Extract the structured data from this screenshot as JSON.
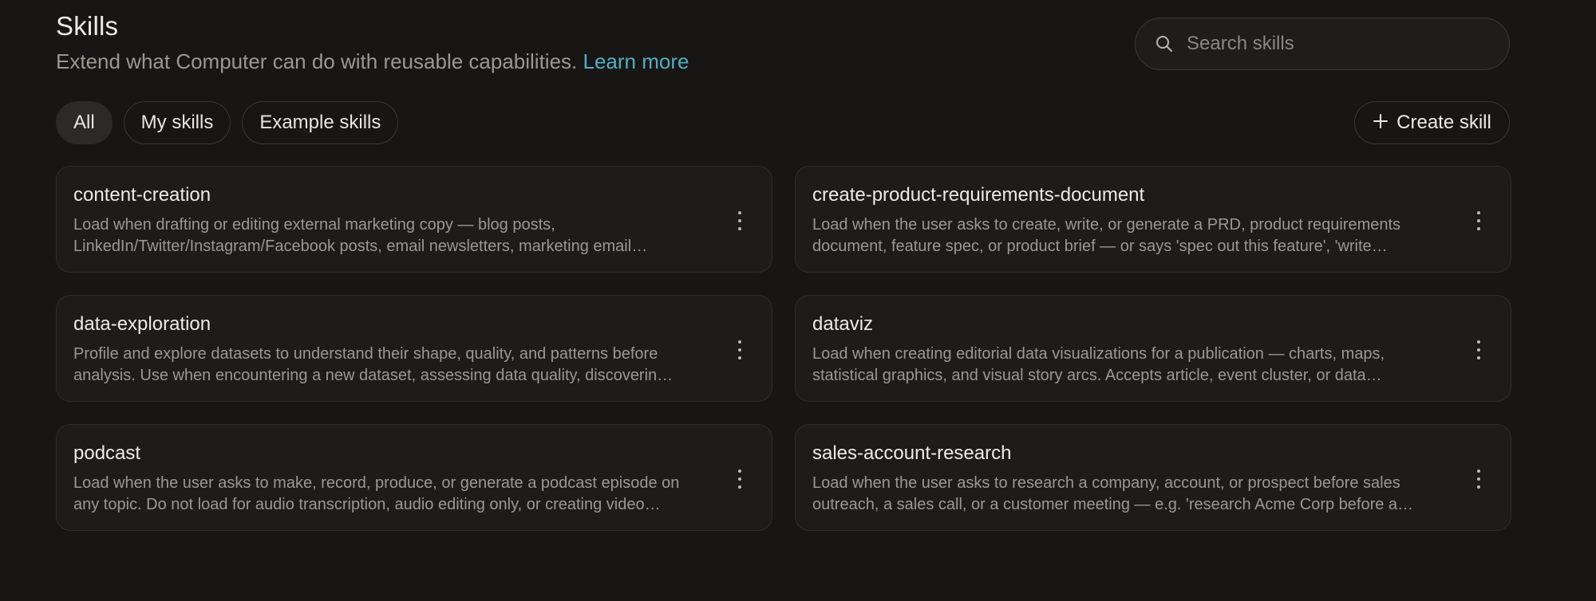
{
  "header": {
    "title": "Skills",
    "subtitle": "Extend what Computer can do with reusable capabilities.",
    "learn_more": "Learn more"
  },
  "search": {
    "placeholder": "Search skills",
    "icon": "search-icon"
  },
  "filters": {
    "all": "All",
    "my_skills": "My skills",
    "example_skills": "Example skills",
    "active": "All"
  },
  "create_button": {
    "label": "Create skill",
    "icon": "plus-icon"
  },
  "colors": {
    "background": "#171615",
    "card": "#1d1c1b",
    "link": "#4fb0c0"
  },
  "skills": [
    {
      "name": "content-creation",
      "description": "Load when drafting or editing external marketing copy — blog posts, LinkedIn/Twitter/Instagram/Facebook posts, email newsletters, marketing email…"
    },
    {
      "name": "create-product-requirements-document",
      "description": "Load when the user asks to create, write, or generate a PRD, product requirements document, feature spec, or product brief — or says 'spec out this feature', 'write…"
    },
    {
      "name": "data-exploration",
      "description": "Profile and explore datasets to understand their shape, quality, and patterns before analysis. Use when encountering a new dataset, assessing data quality, discoverin…"
    },
    {
      "name": "dataviz",
      "description": "Load when creating editorial data visualizations for a publication — charts, maps, statistical graphics, and visual story arcs. Accepts article, event cluster, or data…"
    },
    {
      "name": "podcast",
      "description": "Load when the user asks to make, record, produce, or generate a podcast episode on any topic. Do not load for audio transcription, audio editing only, or creating video…"
    },
    {
      "name": "sales-account-research",
      "description": "Load when the user asks to research a company, account, or prospect before sales outreach, a sales call, or a customer meeting — e.g. 'research Acme Corp before a…"
    }
  ]
}
